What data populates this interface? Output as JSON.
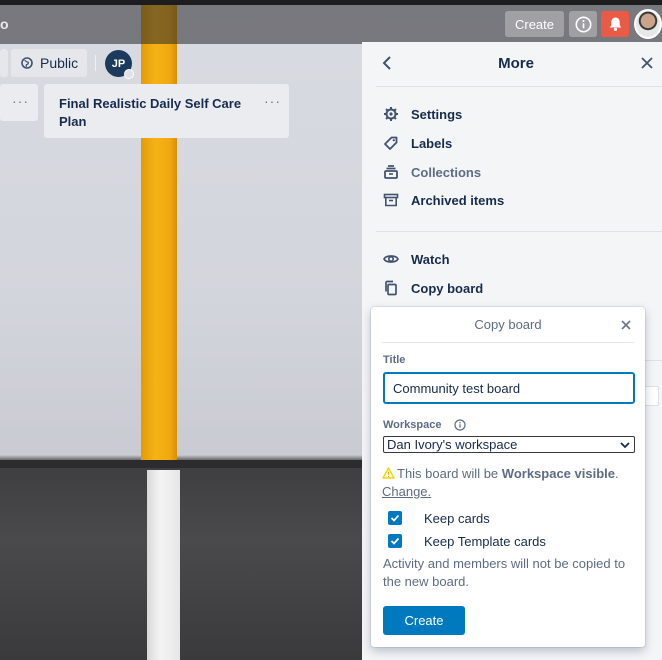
{
  "header": {
    "logo_fragment": "o",
    "create_label": "Create"
  },
  "board": {
    "visibility_label": "Public",
    "member_initials": "JP",
    "lists": [
      {
        "title": "Final Realistic Daily Self Care Plan"
      }
    ],
    "list_menu_glyph": "···"
  },
  "sidebar": {
    "title": "More",
    "items": [
      {
        "label": "Settings",
        "icon": "gear-icon"
      },
      {
        "label": "Labels",
        "icon": "label-icon"
      },
      {
        "label": "Collections",
        "icon": "collections-icon"
      },
      {
        "label": "Archived items",
        "icon": "archive-icon"
      },
      {
        "label": "Watch",
        "icon": "eye-icon"
      },
      {
        "label": "Copy board",
        "icon": "copy-icon"
      }
    ]
  },
  "copy_board": {
    "title": "Copy board",
    "title_label": "Title",
    "title_value": "Community test board",
    "workspace_label": "Workspace",
    "workspace_value": "Dan Ivory's workspace",
    "notice_prefix": "This board will be ",
    "notice_bold": "Workspace visible",
    "notice_suffix": ".",
    "change_link": "Change.",
    "keep_cards_label": "Keep cards",
    "keep_cards_checked": true,
    "keep_templates_label": "Keep Template cards",
    "keep_templates_checked": true,
    "footnote": "Activity and members will not be copied to the new board.",
    "create_label": "Create"
  },
  "colors": {
    "accent": "#0079bf",
    "notification": "#eb5a46",
    "warning": "#f2d600"
  }
}
